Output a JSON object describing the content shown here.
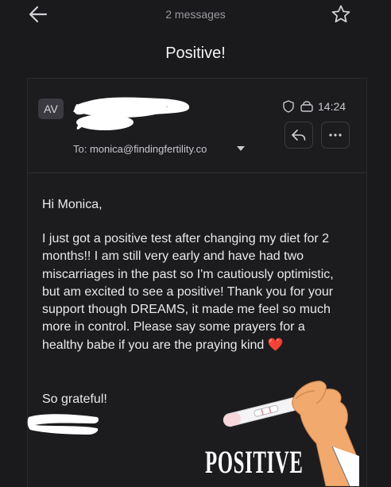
{
  "header": {
    "message_count": "2 messages",
    "subject": "Positive!"
  },
  "email": {
    "avatar_initials": "AV",
    "sender_initial": "A",
    "time": "14:24",
    "to_label": "To:",
    "to_address": "monica@findingfertility.co",
    "greeting": "Hi Monica,",
    "body": "I just got a positive test after changing my diet for 2 months!! I am still very early and have had two miscarriages in the past so I'm cautiously optimistic, but am excited to see a positive! Thank you for your support though DREAMS, it made me feel so much more in control. Please say some prayers for a healthy babe if you are the praying kind",
    "heart": "❤️",
    "signoff": "So grateful!"
  },
  "sticker": {
    "text": "POSITIVE"
  },
  "icons": {
    "back": "back-arrow-icon",
    "star": "star-icon",
    "shield": "shield-icon",
    "lock": "lock-icon",
    "reply": "reply-icon",
    "more": "more-icon",
    "caret": "chevron-down-icon"
  },
  "colors": {
    "background": "#1a1a1c",
    "card": "#1c1c1f",
    "heart": "#e0303a",
    "skin": "#f2a96e"
  }
}
